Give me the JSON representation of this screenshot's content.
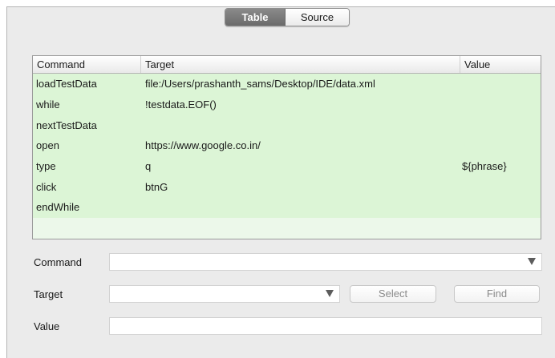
{
  "tabs": {
    "table_label": "Table",
    "source_label": "Source",
    "active": "Table"
  },
  "grid": {
    "columns": [
      "Command",
      "Target",
      "Value"
    ],
    "rows": [
      {
        "command": "loadTestData",
        "target": "file:/Users/prashanth_sams/Desktop/IDE/data.xml",
        "value": ""
      },
      {
        "command": "while",
        "target": "!testdata.EOF()",
        "value": ""
      },
      {
        "command": "nextTestData",
        "target": "",
        "value": ""
      },
      {
        "command": "open",
        "target": "https://www.google.co.in/",
        "value": ""
      },
      {
        "command": "type",
        "target": "q",
        "value": "${phrase}"
      },
      {
        "command": "click",
        "target": "btnG",
        "value": ""
      },
      {
        "command": "endWhile",
        "target": "",
        "value": ""
      }
    ]
  },
  "form": {
    "command_label": "Command",
    "command_value": "",
    "target_label": "Target",
    "target_value": "",
    "value_label": "Value",
    "value_value": "",
    "select_label": "Select",
    "find_label": "Find"
  },
  "colors": {
    "row_background": "#dcf5d6",
    "grid_background": "#ecf8ea",
    "panel_background": "#ebebeb",
    "active_tab": "#7a7a7a"
  }
}
